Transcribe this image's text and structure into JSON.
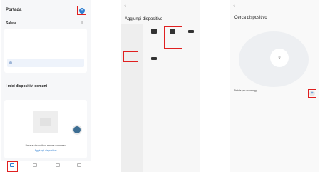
{
  "screen1": {
    "title": "Portada",
    "add_icon": "plus-icon",
    "tabs": [
      "Salute",
      "",
      ""
    ],
    "location": "",
    "temperature": "",
    "my_devices_title": "I miei dispositivi comuni",
    "empty_text": "Nessun dispositivo ancora connesso",
    "add_link": "Aggiungi dispositivo",
    "nav_items": [
      {
        "label": "",
        "icon": "home-icon"
      },
      {
        "label": "",
        "icon": "scene-icon"
      },
      {
        "label": "",
        "icon": "smart-icon"
      },
      {
        "label": "",
        "icon": "profile-icon"
      }
    ]
  },
  "screen2": {
    "back_label": "<",
    "title": "Aggiungi dispositivo",
    "categories": [
      "",
      "",
      ""
    ],
    "devices": [
      {
        "name": "",
        "icon": "gun-icon"
      },
      {
        "name": "",
        "icon": "massage-gun-icon"
      },
      {
        "name": "",
        "icon": "mask-icon"
      },
      {
        "name": "",
        "icon": "eye-mask-icon"
      }
    ]
  },
  "screen3": {
    "back_label": "<",
    "title": "Cerca dispositivo",
    "radar_text": "0",
    "found_label": "Pistola per massaggi",
    "found_sub": "",
    "add_icon": "plus-icon"
  },
  "colors": {
    "accent": "#2f7fd1",
    "highlight": "#e02020"
  }
}
